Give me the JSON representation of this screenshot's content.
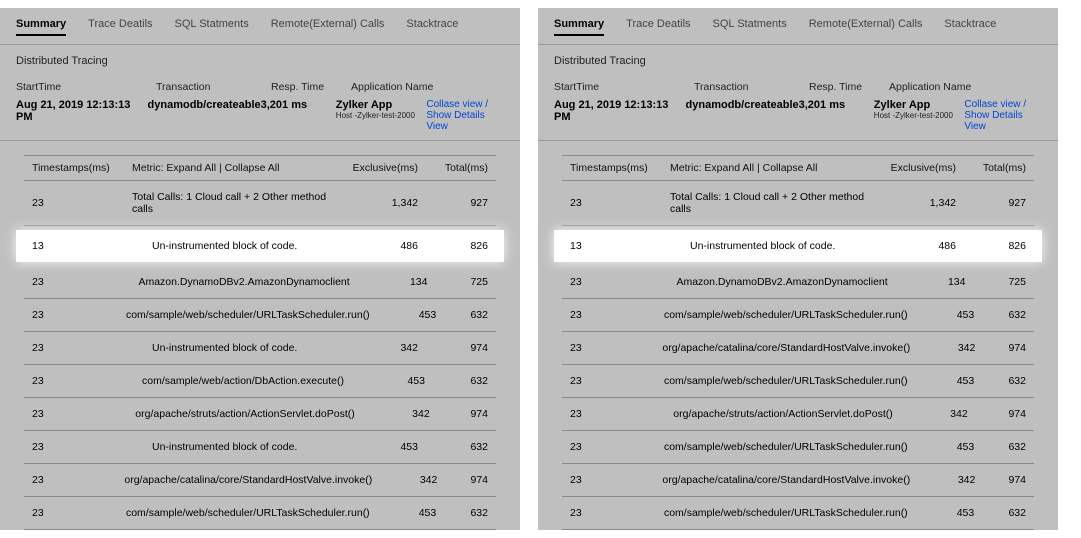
{
  "tabs": {
    "summary": "Summary",
    "trace": "Trace Deatils",
    "sql": "SQL Statments",
    "remote": "Remote(External) Calls",
    "stack": "Stacktrace"
  },
  "section": "Distributed Tracing",
  "headers": {
    "start": "StartTime",
    "txn": "Transaction",
    "resp": "Resp. Time",
    "app": "Application Name"
  },
  "summary": {
    "start": "Aug 21, 2019 12:13:13 PM",
    "txn": "dynamodb/createable",
    "resp": "3,201 ms",
    "app": "Zylker App",
    "host": "Host -Zylker-test-2000"
  },
  "actions": {
    "collapse": "Collase view /",
    "details": "Show Details View"
  },
  "trace_headers": {
    "ts": "Timestamps(ms)",
    "metric_prefix": "Metric: ",
    "expand": "Expand All",
    "separator": " | ",
    "collapse": "Collapse All",
    "excl": "Exclusive(ms)",
    "tot": "Total(ms)"
  },
  "left_rows": [
    {
      "ts": "23",
      "metric": "Total Calls: 1 Cloud call + 2 Other method calls",
      "excl": "1,342",
      "tot": "927",
      "total": true
    },
    {
      "ts": "13",
      "metric": "Un-instrumented block of code.",
      "excl": "486",
      "tot": "826",
      "highlight": true
    },
    {
      "ts": "23",
      "metric": "Amazon.DynamoDBv2.AmazonDynamoclient",
      "excl": "134",
      "tot": "725"
    },
    {
      "ts": "23",
      "metric": "com/sample/web/scheduler/URLTaskScheduler.run()",
      "excl": "453",
      "tot": "632"
    },
    {
      "ts": "23",
      "metric": "Un-instrumented block of code.",
      "excl": "342",
      "tot": "974"
    },
    {
      "ts": "23",
      "metric": "com/sample/web/action/DbAction.execute()",
      "excl": "453",
      "tot": "632"
    },
    {
      "ts": "23",
      "metric": "org/apache/struts/action/ActionServlet.doPost()",
      "excl": "342",
      "tot": "974"
    },
    {
      "ts": "23",
      "metric": "Un-instrumented block of code.",
      "excl": "453",
      "tot": "632"
    },
    {
      "ts": "23",
      "metric": "org/apache/catalina/core/StandardHostValve.invoke()",
      "excl": "342",
      "tot": "974"
    },
    {
      "ts": "23",
      "metric": "com/sample/web/scheduler/URLTaskScheduler.run()",
      "excl": "453",
      "tot": "632"
    }
  ],
  "right_rows": [
    {
      "ts": "23",
      "metric": "Total Calls: 1 Cloud call + 2 Other method calls",
      "excl": "1,342",
      "tot": "927",
      "total": true
    },
    {
      "ts": "13",
      "metric": "Un-instrumented block of code.",
      "excl": "486",
      "tot": "826",
      "highlight": true
    },
    {
      "ts": "23",
      "metric": "Amazon.DynamoDBv2.AmazonDynamoclient",
      "excl": "134",
      "tot": "725"
    },
    {
      "ts": "23",
      "metric": "com/sample/web/scheduler/URLTaskScheduler.run()",
      "excl": "453",
      "tot": "632"
    },
    {
      "ts": "23",
      "metric": "org/apache/catalina/core/StandardHostValve.invoke()",
      "excl": "342",
      "tot": "974"
    },
    {
      "ts": "23",
      "metric": "com/sample/web/scheduler/URLTaskScheduler.run()",
      "excl": "453",
      "tot": "632"
    },
    {
      "ts": "23",
      "metric": "org/apache/struts/action/ActionServlet.doPost()",
      "excl": "342",
      "tot": "974"
    },
    {
      "ts": "23",
      "metric": "com/sample/web/scheduler/URLTaskScheduler.run()",
      "excl": "453",
      "tot": "632"
    },
    {
      "ts": "23",
      "metric": "org/apache/catalina/core/StandardHostValve.invoke()",
      "excl": "342",
      "tot": "974"
    },
    {
      "ts": "23",
      "metric": "com/sample/web/scheduler/URLTaskScheduler.run()",
      "excl": "453",
      "tot": "632"
    }
  ]
}
